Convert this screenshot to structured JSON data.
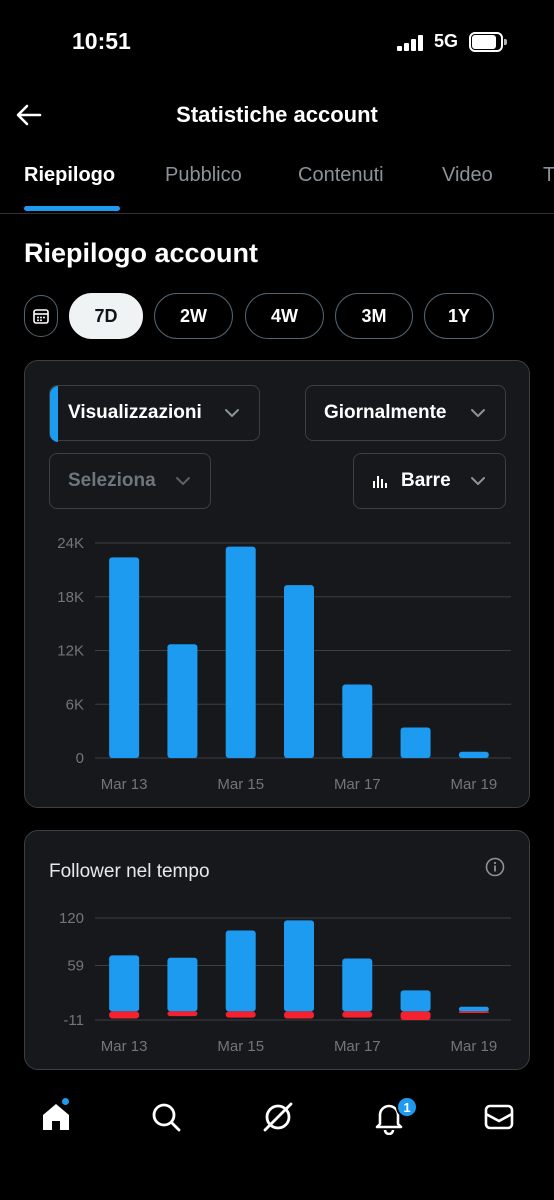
{
  "status": {
    "time": "10:51",
    "network": "5G"
  },
  "header": {
    "title": "Statistiche account"
  },
  "tabs": [
    {
      "label": "Riepilogo"
    },
    {
      "label": "Pubblico"
    },
    {
      "label": "Contenuti"
    },
    {
      "label": "Video"
    },
    {
      "label": "T"
    }
  ],
  "section": {
    "title": "Riepilogo account"
  },
  "periods": [
    {
      "label": "7D"
    },
    {
      "label": "2W"
    },
    {
      "label": "4W"
    },
    {
      "label": "3M"
    },
    {
      "label": "1Y"
    }
  ],
  "filters": {
    "metric": "Visualizzazioni",
    "granularity": "Giornalmente",
    "compare": "Seleziona",
    "chart_type": "Barre"
  },
  "follower_card": {
    "title": "Follower nel tempo"
  },
  "notifications": {
    "badge": "1"
  },
  "colors": {
    "accent": "#1d9bf0",
    "negative": "#f4212e",
    "card": "#16181c"
  },
  "chart_data": [
    {
      "type": "bar",
      "categories": [
        "Mar 13",
        "Mar 14",
        "Mar 15",
        "Mar 16",
        "Mar 17",
        "Mar 18",
        "Mar 19"
      ],
      "x_tick_labels": [
        "Mar 13",
        "Mar 15",
        "Mar 17",
        "Mar 19"
      ],
      "y_tick_labels": [
        "24K",
        "18K",
        "12K",
        "6K",
        "0"
      ],
      "yticks": [
        24000,
        18000,
        12000,
        6000,
        0
      ],
      "ylim": [
        0,
        24000
      ],
      "grid": true,
      "series": [
        {
          "values": [
            22400,
            12700,
            23600,
            19300,
            8200,
            3400,
            700
          ],
          "color": "#1d9bf0"
        }
      ]
    },
    {
      "type": "bar",
      "title": "Follower nel tempo",
      "categories": [
        "Mar 13",
        "Mar 14",
        "Mar 15",
        "Mar 16",
        "Mar 17",
        "Mar 18",
        "Mar 19"
      ],
      "x_tick_labels": [
        "Mar 13",
        "Mar 15",
        "Mar 17",
        "Mar 19"
      ],
      "y_tick_labels": [
        "120",
        "59",
        "-11"
      ],
      "yticks": [
        120,
        59,
        -11
      ],
      "ylim": [
        -11,
        120
      ],
      "grid": true,
      "stacked": true,
      "series": [
        {
          "values": [
            72,
            69,
            104,
            117,
            68,
            27,
            6
          ],
          "color": "#1d9bf0"
        },
        {
          "values": [
            -9,
            -6,
            -8,
            -9,
            -8,
            -11,
            -2
          ],
          "color": "#f4212e"
        }
      ]
    }
  ]
}
